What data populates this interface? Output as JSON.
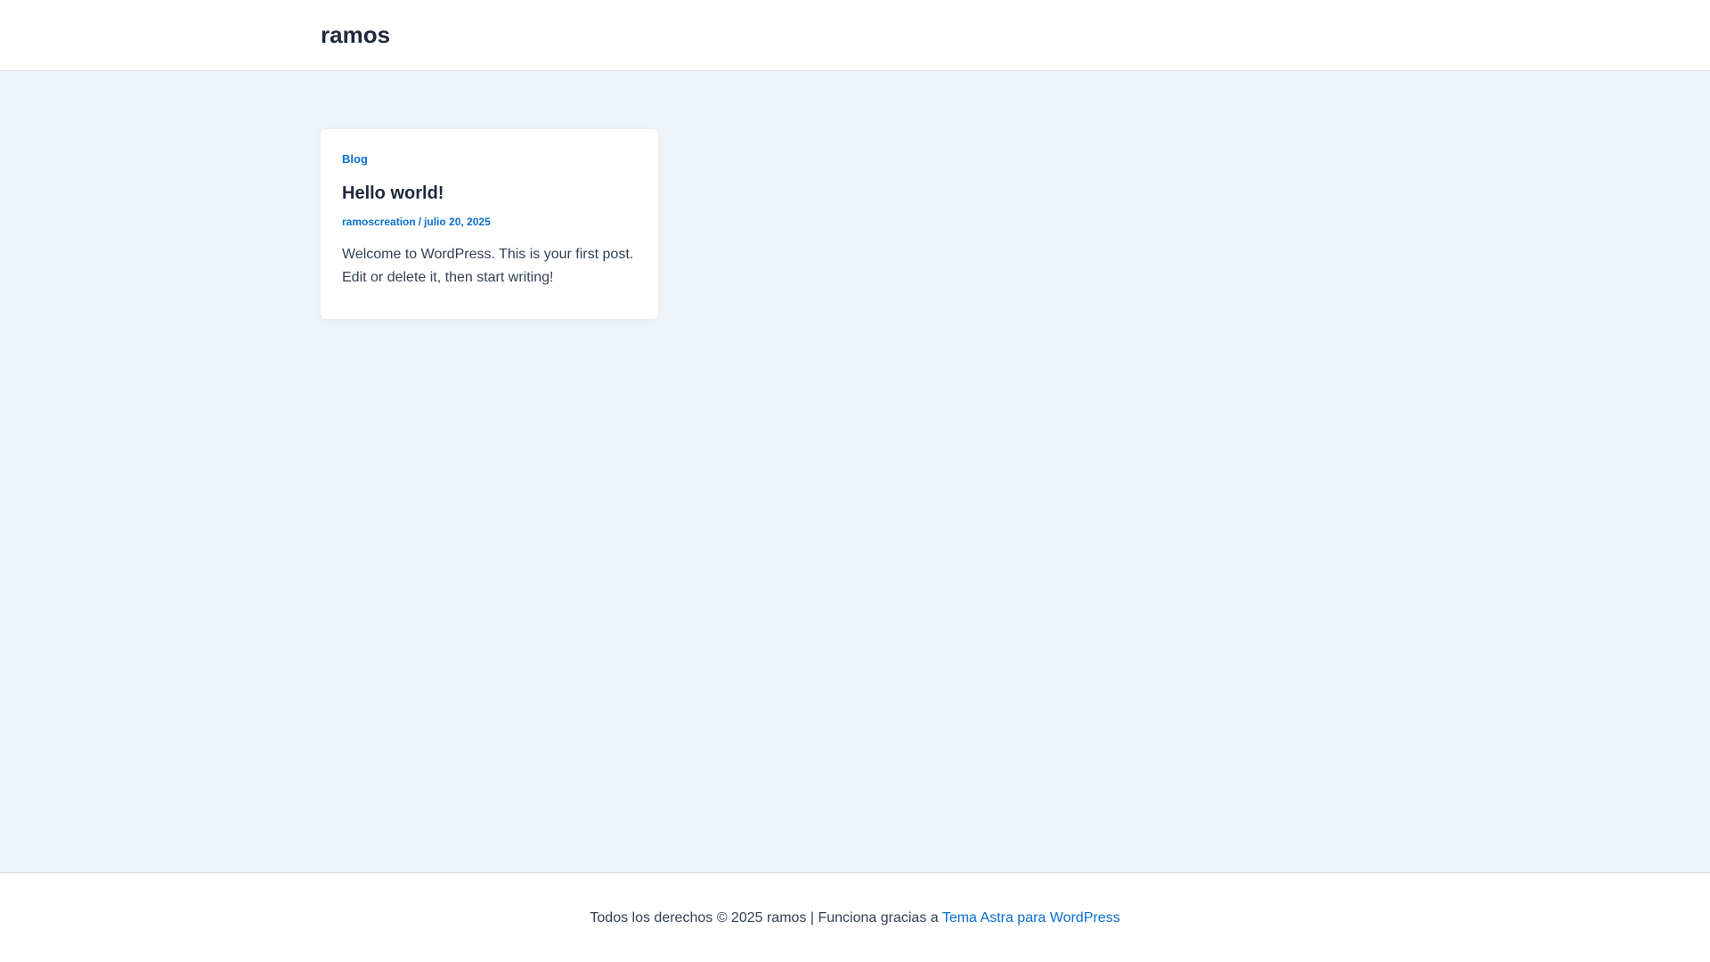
{
  "header": {
    "site_title": "ramos"
  },
  "post": {
    "category": "Blog",
    "title": "Hello world!",
    "author": "ramoscreation",
    "separator": "/",
    "date": "julio 20, 2025",
    "excerpt": "Welcome to WordPress. This is your first post. Edit or delete it, then start writing!"
  },
  "footer": {
    "copyright_text": "Todos los derechos © 2025 ramos | Funciona gracias a ",
    "theme_link": "Tema Astra para WordPress"
  },
  "colors": {
    "accent": "#0a6fd1",
    "heading": "#1e293b",
    "body_text": "#334155",
    "page_background": "#eff4f8",
    "surface": "#ffffff"
  }
}
